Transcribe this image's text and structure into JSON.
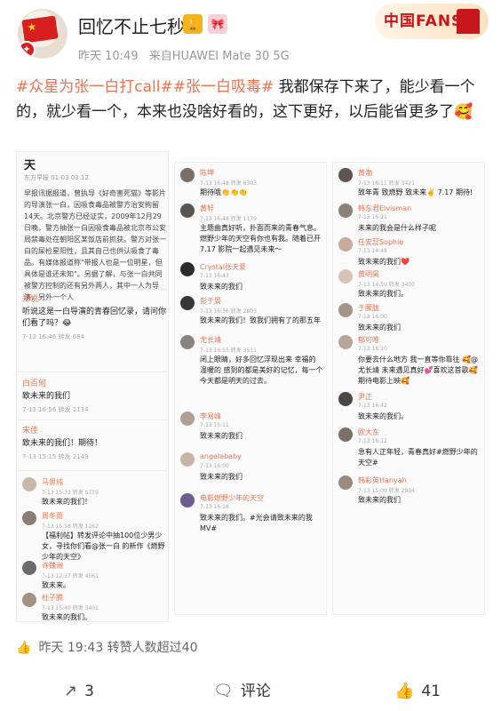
{
  "user": {
    "name": "回忆不止七秒",
    "time": "昨天 10:49",
    "source": "来自HUAWEI Mate 30 5G",
    "fans_badge": "中国FANS",
    "badge1": "🏆",
    "badge2": "🎀"
  },
  "post": {
    "tag1": "#众星为张一白打call#",
    "tag2": "#张一白吸毒#",
    "text": " 我都保存下来了，能少看一个的，就少看一个，本来也没啥好看的，这下更好，以后能省更多了🥰"
  },
  "left_shot": {
    "title": "天",
    "subtitle": "东方早报 01-03 03:12",
    "article": "早报讯据报道，曾执导《好奇害死猫》等影片的导演张一白，因吸食毒品被警方治安拘留14天。北京警方已经证实，2009年12月29日晚，警方抽张一白因吸食毒品被北京市公安局禁毒处在朝阳区某饭店前抓获。警方对张一白的尿检星阳性，且其自己也供认吸食了毒品。有媒体报道称\"带报人也是一位明星，但具体是谁还未知\"。另据了解，与张一白共同被警方控制的还有另外两人，其中一人为导演，另外一个人",
    "comments": [
      {
        "name": "郑悦",
        "text": "听说这是一白导演的青春回忆录，请问你们看了吗？😂",
        "meta": "7-13 16:46  转发 684"
      },
      {
        "name": "白百何",
        "text": "致未来的我们",
        "meta": "7-13 16:56  转发 1134"
      },
      {
        "name": "宋佳",
        "text": "致未来的我们！期待！",
        "meta": "7-13 15:15  转发 2149"
      }
    ],
    "replies": [
      {
        "name": "马思纯",
        "time": "7-13 15:32  转发 5779",
        "text": "致未来的我们！"
      },
      {
        "name": "周冬雨",
        "time": "7-13 15:58  转发 1262",
        "text": "【福利帖】转发评论中抽100位少男少女，寻找你们看@张一白 的新作《燃野少年的天空》"
      },
      {
        "name": "许魏洲",
        "time": "7-13 12:37  转发 4561",
        "text": "致未来。"
      },
      {
        "name": "杜子腾",
        "time": "7-13 15:40  转发 3401",
        "text": "致未来的我们。"
      }
    ]
  },
  "mid_shot": {
    "replies": [
      {
        "name": "陈坤",
        "time": "7-13 16:48  转发 6393",
        "text": "期待哦👏👏👏"
      },
      {
        "name": "黄轩",
        "time": "7-13 16:48  转发 1179",
        "text": "主题曲真好听，扑面而来的青春气息。燃野少年的天空有你也有我。随着已开 7.17 影院一起遇见未来～"
      },
      {
        "name": "Crystal张天爱",
        "time": "7-13 16:43",
        "text": "致未来的我们"
      },
      {
        "name": "彭于晏",
        "time": "7-13 16:36  转发 2803",
        "text": "致未来的我们！致我们拥有了的那五年"
      },
      {
        "name": "尤长靖",
        "time": "7-13 16:55  转发 3511",
        "text": "闭上眼睛，好多回忆浮现出来 幸福的 温暖的 感到的都是美好的记忆，每一个今天都是明天的过去。"
      },
      {
        "name": "李易峰",
        "time": "7-13 15:11",
        "text": "致未来的我们"
      },
      {
        "name": "angelababy",
        "time": "7-13 16:00",
        "text": "致未来的我们"
      },
      {
        "name": "电影燃野少年的天空",
        "time": "7-13 16:18",
        "text": "致未来的我们。#光会请致未来的我MV#"
      }
    ]
  },
  "right_shot": {
    "replies": [
      {
        "name": "黄渤",
        "time": "7-13 16:11  转发 3421",
        "text": "致年青 致燃野 致未来✌️ 7.17 期待!"
      },
      {
        "name": "韩东君Elvisman",
        "time": "7-13 16:21",
        "text": "未来的我会是什么样子呢"
      },
      {
        "name": "任安蕊Sophie",
        "time": "7-13 14:48",
        "text": "致未来的我们❤️"
      },
      {
        "name": "黄明昊",
        "time": "7-13 14:59  转发 3400",
        "text": "致未来的我们。"
      },
      {
        "name": "于朦胧",
        "time": "7-13 16:00",
        "text": "致未来的我们"
      },
      {
        "name": "郁可唯",
        "time": "7-13 16:10",
        "text": "你要去什么地方 我一直等你靠往 🥰@尤长靖 未来遇见真好💕喜欢这首歌🥰期待电影上映🥰"
      },
      {
        "name": "尹正",
        "time": "7-13 16:42",
        "text": "致未来的我们。"
      },
      {
        "name": "欧大东",
        "time": "7-13 16:12",
        "text": "急有人正年轻，青春真好#燃野少年的天空#"
      },
      {
        "name": "韩彩英Hanyah",
        "time": "7-13 15:09  转发 2804",
        "text": "致未来的我们"
      }
    ]
  },
  "footer": {
    "repost_info": "昨天 19:43 转赞人数超过40",
    "share_count": "3",
    "comment_label": "评论",
    "like_count": "41"
  }
}
